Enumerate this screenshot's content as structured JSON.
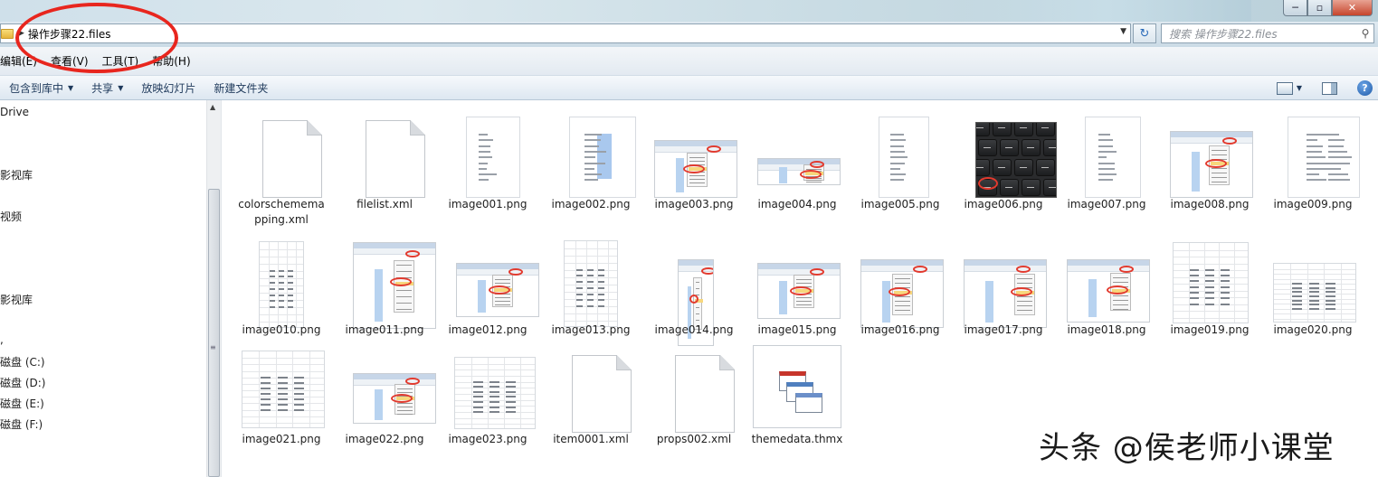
{
  "window": {
    "controls": {
      "minimize": "─",
      "maximize": "▫",
      "close": "✕"
    }
  },
  "address_bar": {
    "path": "操作步骤22.files",
    "search_placeholder": "搜索 操作步骤22.files"
  },
  "menu": {
    "items": [
      "编辑(E)",
      "查看(V)",
      "工具(T)",
      "帮助(H)"
    ]
  },
  "toolbar": {
    "include_label": "包含到库中",
    "share_label": "共享",
    "slideshow_label": "放映幻灯片",
    "new_folder_label": "新建文件夹"
  },
  "nav": {
    "items": [
      "Drive",
      "影视库",
      "视频",
      "影视库",
      ",",
      "磁盘 (C:)",
      "磁盘 (D:)",
      "磁盘 (E:)",
      "磁盘 (F:)"
    ]
  },
  "files": [
    "colorschememapping.xml",
    "filelist.xml",
    "image001.png",
    "image002.png",
    "image003.png",
    "image004.png",
    "image005.png",
    "image006.png",
    "image007.png",
    "image008.png",
    "image009.png",
    "image010.png",
    "image011.png",
    "image012.png",
    "image013.png",
    "image014.png",
    "image015.png",
    "image016.png",
    "image017.png",
    "image018.png",
    "image019.png",
    "image020.png",
    "image021.png",
    "image022.png",
    "image023.png",
    "item0001.xml",
    "props002.xml",
    "themedata.thmx"
  ],
  "watermark": "头条 @侯老师小课堂",
  "colors": {
    "annotation_red": "#e8261e",
    "selection_blue": "#a9c8ee"
  },
  "icons": [
    "folder-icon",
    "refresh-icon",
    "search-icon",
    "help-icon",
    "view-options-icon",
    "preview-pane-icon"
  ]
}
